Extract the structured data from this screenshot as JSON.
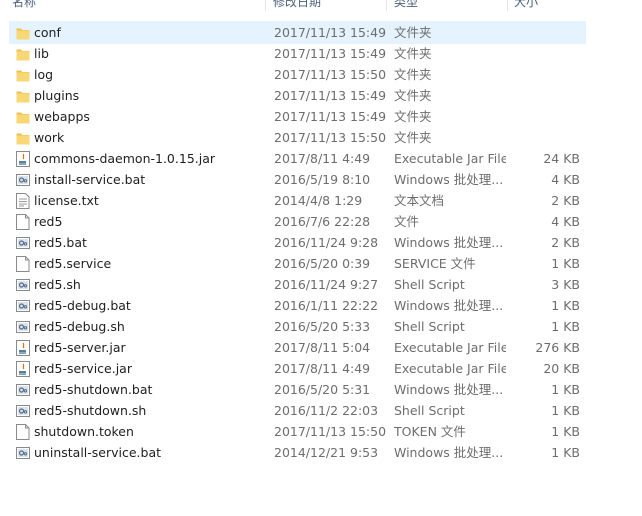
{
  "columns": {
    "name": "名称",
    "date": "修改日期",
    "type": "类型",
    "size": "大小"
  },
  "files": [
    {
      "name": "conf",
      "date": "2017/11/13 15:49",
      "type": "文件夹",
      "size": "",
      "icon": "folder-icon",
      "selected": true
    },
    {
      "name": "lib",
      "date": "2017/11/13 15:49",
      "type": "文件夹",
      "size": "",
      "icon": "folder-icon"
    },
    {
      "name": "log",
      "date": "2017/11/13 15:50",
      "type": "文件夹",
      "size": "",
      "icon": "folder-icon"
    },
    {
      "name": "plugins",
      "date": "2017/11/13 15:49",
      "type": "文件夹",
      "size": "",
      "icon": "folder-icon"
    },
    {
      "name": "webapps",
      "date": "2017/11/13 15:49",
      "type": "文件夹",
      "size": "",
      "icon": "folder-icon"
    },
    {
      "name": "work",
      "date": "2017/11/13 15:50",
      "type": "文件夹",
      "size": "",
      "icon": "folder-icon"
    },
    {
      "name": "commons-daemon-1.0.15.jar",
      "date": "2017/8/11 4:49",
      "type": "Executable Jar File",
      "size": "24 KB",
      "icon": "jar-file-icon"
    },
    {
      "name": "install-service.bat",
      "date": "2016/5/19 8:10",
      "type": "Windows 批处理...",
      "size": "4 KB",
      "icon": "batch-file-icon"
    },
    {
      "name": "license.txt",
      "date": "2014/4/8 1:29",
      "type": "文本文档",
      "size": "2 KB",
      "icon": "text-file-icon"
    },
    {
      "name": "red5",
      "date": "2016/7/6 22:28",
      "type": "文件",
      "size": "4 KB",
      "icon": "blank-file-icon"
    },
    {
      "name": "red5.bat",
      "date": "2016/11/24 9:28",
      "type": "Windows 批处理...",
      "size": "2 KB",
      "icon": "batch-file-icon"
    },
    {
      "name": "red5.service",
      "date": "2016/5/20 0:39",
      "type": "SERVICE 文件",
      "size": "1 KB",
      "icon": "blank-file-icon"
    },
    {
      "name": "red5.sh",
      "date": "2016/11/24 9:27",
      "type": "Shell Script",
      "size": "3 KB",
      "icon": "batch-file-icon"
    },
    {
      "name": "red5-debug.bat",
      "date": "2016/1/11 22:22",
      "type": "Windows 批处理...",
      "size": "1 KB",
      "icon": "batch-file-icon"
    },
    {
      "name": "red5-debug.sh",
      "date": "2016/5/20 5:33",
      "type": "Shell Script",
      "size": "1 KB",
      "icon": "batch-file-icon"
    },
    {
      "name": "red5-server.jar",
      "date": "2017/8/11 5:04",
      "type": "Executable Jar File",
      "size": "276 KB",
      "icon": "jar-file-icon"
    },
    {
      "name": "red5-service.jar",
      "date": "2017/8/11 4:49",
      "type": "Executable Jar File",
      "size": "20 KB",
      "icon": "jar-file-icon"
    },
    {
      "name": "red5-shutdown.bat",
      "date": "2016/5/20 5:31",
      "type": "Windows 批处理...",
      "size": "1 KB",
      "icon": "batch-file-icon"
    },
    {
      "name": "red5-shutdown.sh",
      "date": "2016/11/2 22:03",
      "type": "Shell Script",
      "size": "1 KB",
      "icon": "batch-file-icon"
    },
    {
      "name": "shutdown.token",
      "date": "2017/11/13 15:50",
      "type": "TOKEN 文件",
      "size": "1 KB",
      "icon": "blank-file-icon"
    },
    {
      "name": "uninstall-service.bat",
      "date": "2014/12/21 9:53",
      "type": "Windows 批处理...",
      "size": "1 KB",
      "icon": "batch-file-icon"
    }
  ],
  "colors": {
    "selection": "#e5f3ff",
    "folder": "#f8d775",
    "secondary_text": "#6d6d6d"
  }
}
